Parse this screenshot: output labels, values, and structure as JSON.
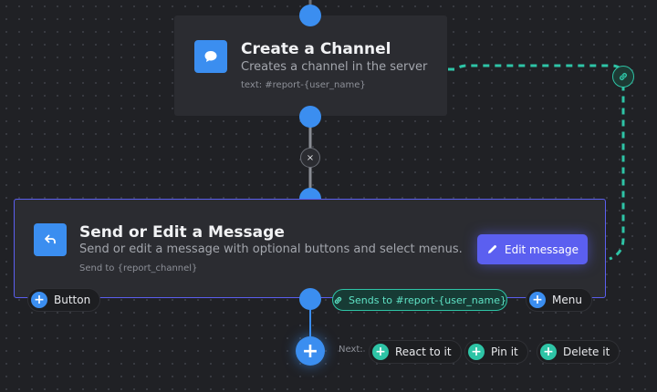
{
  "channel_block": {
    "title": "Create a Channel",
    "description": "Creates a channel in the server",
    "meta": "text: #report-{user_name}",
    "icon": "chat-bubble-icon"
  },
  "message_block": {
    "title": "Send or Edit a Message",
    "description": "Send or edit a message with optional buttons and select menus.",
    "meta": "Send to {report_channel}",
    "icon": "reply-arrow-icon",
    "edit_label": "Edit message"
  },
  "connections": {
    "disconnect_symbol": "×",
    "link_label": "Sends to #report-{user_name}"
  },
  "add_buttons": {
    "button_label": "Button",
    "menu_label": "Menu"
  },
  "next": {
    "label": "Next:",
    "actions": [
      "React to it",
      "Pin it",
      "Delete it"
    ]
  },
  "colors": {
    "accent_blue": "#3b8ef0",
    "accent_purple": "#5b5ff0",
    "accent_teal": "#2ec4a6",
    "canvas": "#202125",
    "card": "#2b2c31"
  }
}
